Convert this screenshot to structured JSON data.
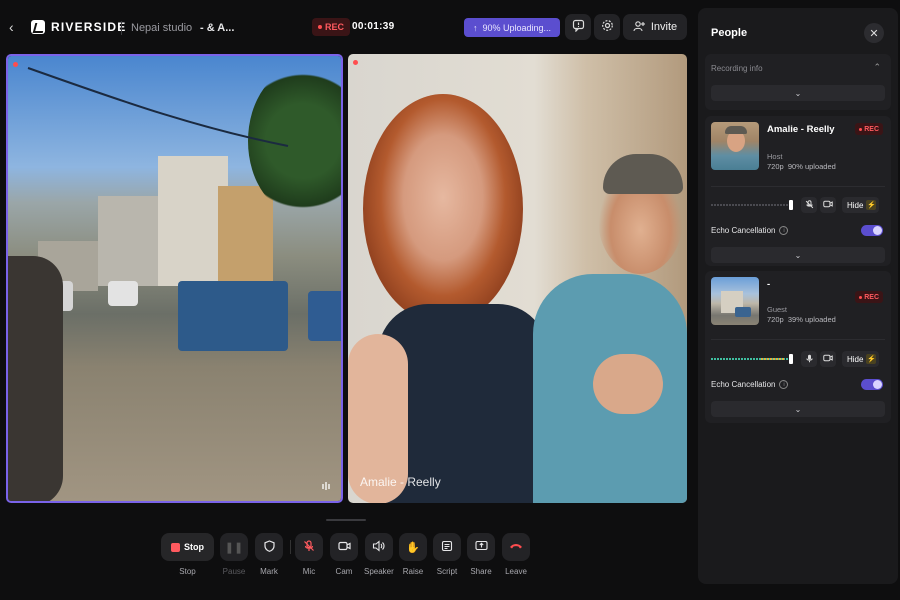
{
  "topbar": {
    "brand": "RIVERSIDE",
    "studio": "Nepai studio",
    "session": "- & A...",
    "rec_label": "REC",
    "timer": "00:01:39",
    "upload_label": "90% Uploading...",
    "invite_label": "Invite"
  },
  "tiles": [
    {
      "name": ""
    },
    {
      "name": "Amalie - Reelly"
    }
  ],
  "controls": [
    {
      "id": "stop",
      "label": "Stop",
      "button_text": "Stop"
    },
    {
      "id": "pause",
      "label": "Pause"
    },
    {
      "id": "mark",
      "label": "Mark"
    },
    {
      "id": "mic",
      "label": "Mic"
    },
    {
      "id": "cam",
      "label": "Cam"
    },
    {
      "id": "speaker",
      "label": "Speaker"
    },
    {
      "id": "raise",
      "label": "Raise"
    },
    {
      "id": "script",
      "label": "Script"
    },
    {
      "id": "share",
      "label": "Share"
    },
    {
      "id": "leave",
      "label": "Leave"
    }
  ],
  "panel": {
    "title": "People",
    "recording_info_label": "Recording info",
    "people": [
      {
        "name": "Amalie - Reelly",
        "role": "Host",
        "resolution": "720p",
        "uploaded": "90% uploaded",
        "rec_label": "REC",
        "hide_label": "Hide",
        "echo_label": "Echo Cancellation",
        "echo_on": true
      },
      {
        "name": "-",
        "role": "Guest",
        "resolution": "720p",
        "uploaded": "39% uploaded",
        "rec_label": "REC",
        "hide_label": "Hide",
        "echo_label": "Echo Cancellation",
        "echo_on": true
      }
    ]
  },
  "colors": {
    "accent": "#5b4ecf",
    "rec_red": "#ff5a5f",
    "panel_bg": "#1a1a1c",
    "tile_border": "#7a63e9"
  }
}
